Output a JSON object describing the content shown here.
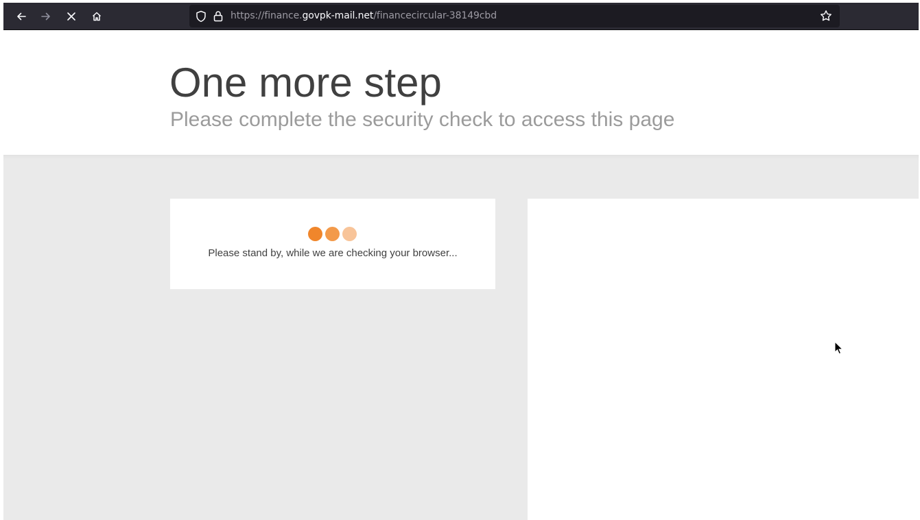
{
  "browser": {
    "url": {
      "scheme": "https://",
      "subdomain": "finance.",
      "domain": "govpk-mail.net",
      "path": "/financecircular-38149cbd"
    },
    "icons": {
      "back": "arrow-left-icon",
      "forward": "arrow-right-icon",
      "stop": "close-icon",
      "home": "home-icon",
      "tracking": "shield-icon",
      "security": "lock-icon",
      "bookmark": "star-icon"
    }
  },
  "page": {
    "title": "One more step",
    "subtitle": "Please complete the security check to access this page",
    "check_message": "Please stand by, while we are checking your browser..."
  },
  "colors": {
    "toolbar_bg": "#2b2a33",
    "urlbar_bg": "#1c1b22",
    "dot_1": "#f0862b",
    "dot_2": "#f39a4a",
    "dot_3": "#f8c499",
    "band_bg": "#eaeaea"
  }
}
